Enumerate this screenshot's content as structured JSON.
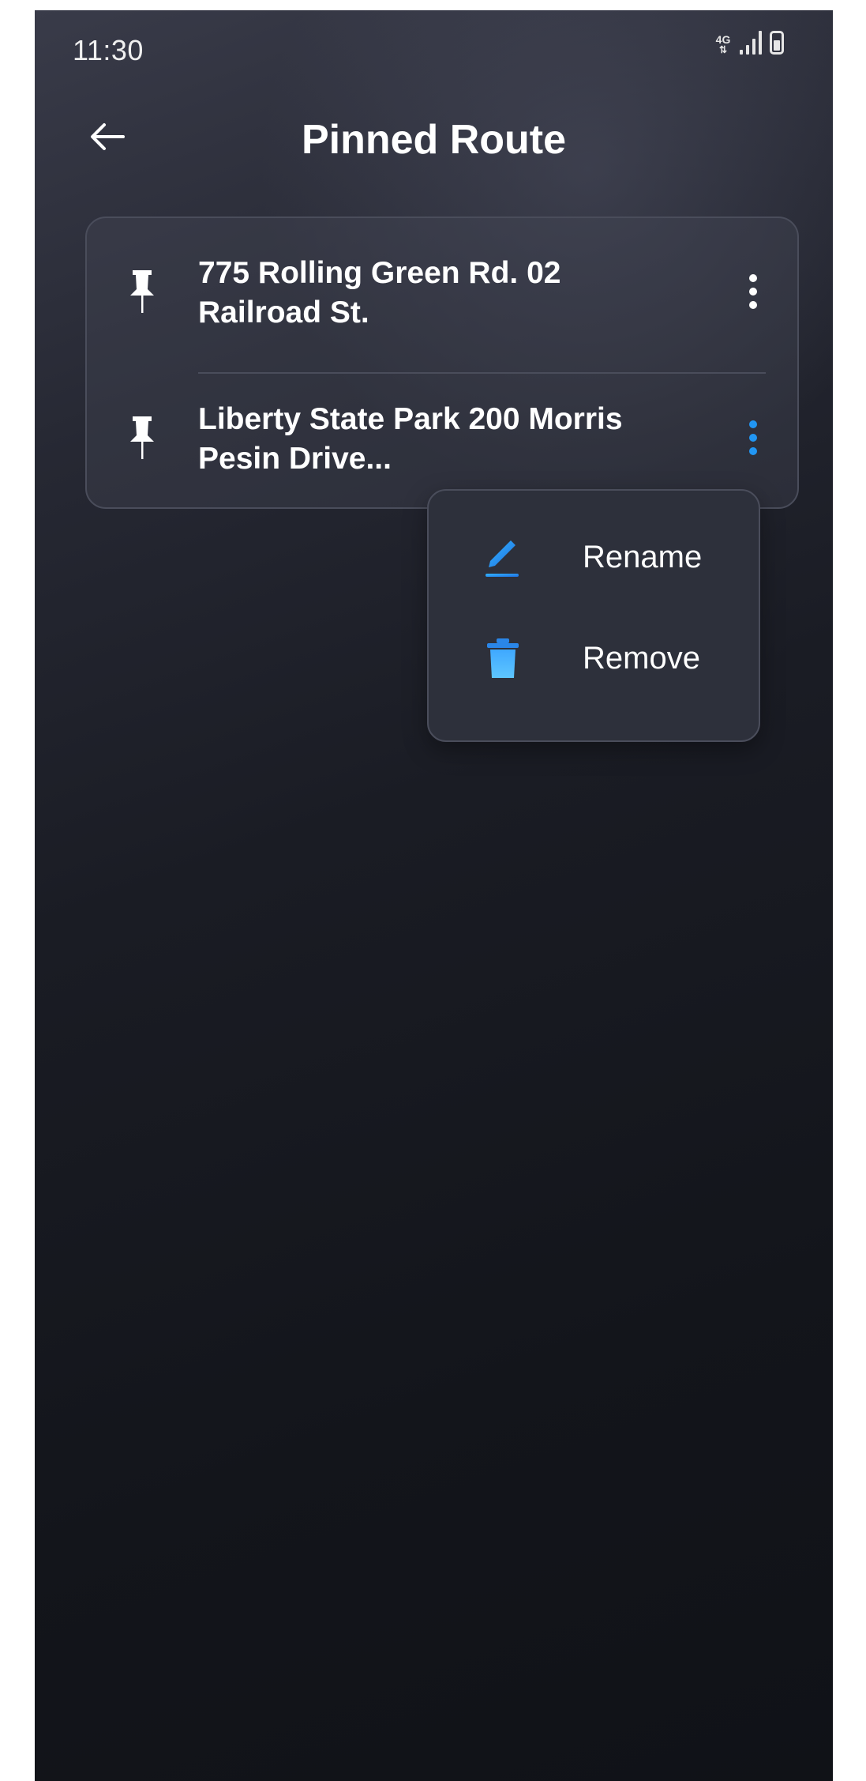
{
  "status_bar": {
    "time": "11:30",
    "network": "4G"
  },
  "header": {
    "title": "Pinned Route",
    "back_icon": "back-arrow-icon"
  },
  "routes": [
    {
      "line1": "775 Rolling Green Rd. 02",
      "line2": "Railroad St.",
      "icon": "pin-icon",
      "menu_active": false
    },
    {
      "line1": "Liberty State Park 200 Morris",
      "line2": "Pesin Drive...",
      "icon": "pin-icon",
      "menu_active": true
    }
  ],
  "context_menu": {
    "items": [
      {
        "label": "Rename",
        "icon": "edit-pencil-icon"
      },
      {
        "label": "Remove",
        "icon": "trash-icon"
      }
    ]
  },
  "colors": {
    "accent": "#2196f3",
    "text": "#ffffff",
    "inactive_dots": "#ffffff"
  }
}
